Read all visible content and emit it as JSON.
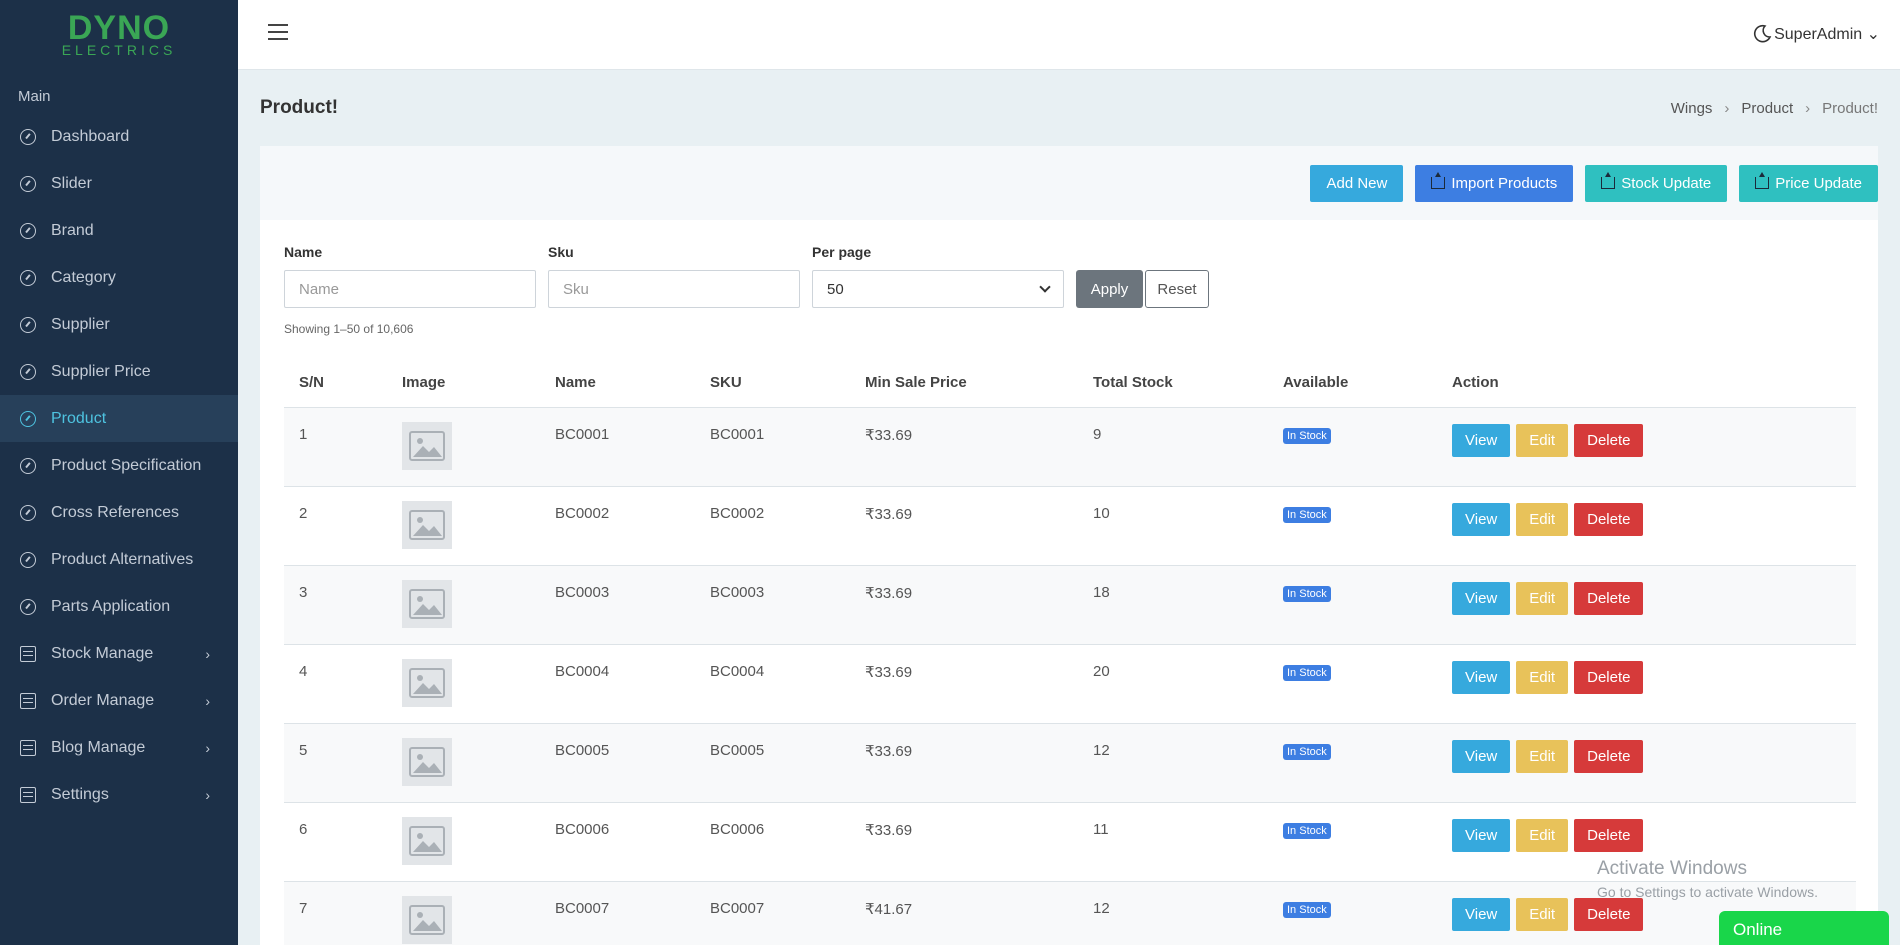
{
  "brand": {
    "logo_main": "DYNO",
    "logo_sub": "ELECTRICS"
  },
  "sidebar": {
    "section": "Main",
    "items": [
      {
        "label": "Dashboard",
        "icon": "gauge-icon",
        "active": false,
        "has_sub": false
      },
      {
        "label": "Slider",
        "icon": "gauge-icon",
        "active": false,
        "has_sub": false
      },
      {
        "label": "Brand",
        "icon": "gauge-icon",
        "active": false,
        "has_sub": false
      },
      {
        "label": "Category",
        "icon": "gauge-icon",
        "active": false,
        "has_sub": false
      },
      {
        "label": "Supplier",
        "icon": "gauge-icon",
        "active": false,
        "has_sub": false
      },
      {
        "label": "Supplier Price",
        "icon": "gauge-icon",
        "active": false,
        "has_sub": false
      },
      {
        "label": "Product",
        "icon": "gauge-icon",
        "active": true,
        "has_sub": false
      },
      {
        "label": "Product Specification",
        "icon": "gauge-icon",
        "active": false,
        "has_sub": false
      },
      {
        "label": "Cross References",
        "icon": "gauge-icon",
        "active": false,
        "has_sub": false
      },
      {
        "label": "Product Alternatives",
        "icon": "gauge-icon",
        "active": false,
        "has_sub": false
      },
      {
        "label": "Parts Application",
        "icon": "gauge-icon",
        "active": false,
        "has_sub": false
      },
      {
        "label": "Stock Manage",
        "icon": "box-icon",
        "active": false,
        "has_sub": true
      },
      {
        "label": "Order Manage",
        "icon": "box-icon",
        "active": false,
        "has_sub": true
      },
      {
        "label": "Blog Manage",
        "icon": "box-icon",
        "active": false,
        "has_sub": true
      },
      {
        "label": "Settings",
        "icon": "box-icon",
        "active": false,
        "has_sub": true
      }
    ]
  },
  "topbar": {
    "user": "SuperAdmin",
    "user_caret": "⌄"
  },
  "page": {
    "title": "Product!",
    "breadcrumb": [
      "Wings",
      "Product",
      "Product!"
    ]
  },
  "actions": {
    "add_new": "Add New",
    "import_products": "Import Products",
    "stock_update": "Stock Update",
    "price_update": "Price Update"
  },
  "filters": {
    "name_label": "Name",
    "name_placeholder": "Name",
    "sku_label": "Sku",
    "sku_placeholder": "Sku",
    "per_page_label": "Per page",
    "per_page_value": "50",
    "apply": "Apply",
    "reset": "Reset",
    "showing": "Showing 1–50 of 10,606"
  },
  "table": {
    "headers": [
      "S/N",
      "Image",
      "Name",
      "SKU",
      "Min Sale Price",
      "Total Stock",
      "Available",
      "Action"
    ],
    "rows": [
      {
        "sn": "1",
        "name": "BC0001",
        "sku": "BC0001",
        "price": "₹33.69",
        "stock": "9",
        "available": "In Stock"
      },
      {
        "sn": "2",
        "name": "BC0002",
        "sku": "BC0002",
        "price": "₹33.69",
        "stock": "10",
        "available": "In Stock"
      },
      {
        "sn": "3",
        "name": "BC0003",
        "sku": "BC0003",
        "price": "₹33.69",
        "stock": "18",
        "available": "In Stock"
      },
      {
        "sn": "4",
        "name": "BC0004",
        "sku": "BC0004",
        "price": "₹33.69",
        "stock": "20",
        "available": "In Stock"
      },
      {
        "sn": "5",
        "name": "BC0005",
        "sku": "BC0005",
        "price": "₹33.69",
        "stock": "12",
        "available": "In Stock"
      },
      {
        "sn": "6",
        "name": "BC0006",
        "sku": "BC0006",
        "price": "₹33.69",
        "stock": "11",
        "available": "In Stock"
      },
      {
        "sn": "7",
        "name": "BC0007",
        "sku": "BC0007",
        "price": "₹41.67",
        "stock": "12",
        "available": "In Stock"
      }
    ],
    "view": "View",
    "edit": "Edit",
    "delete": "Delete"
  },
  "watermark": {
    "line1": "Activate Windows",
    "line2": "Go to Settings to activate Windows."
  },
  "chat": {
    "status": "Online"
  },
  "colors": {
    "sidebar_bg": "#1c3048",
    "accent": "#4ec3e0",
    "brand_green": "#3aa655"
  }
}
